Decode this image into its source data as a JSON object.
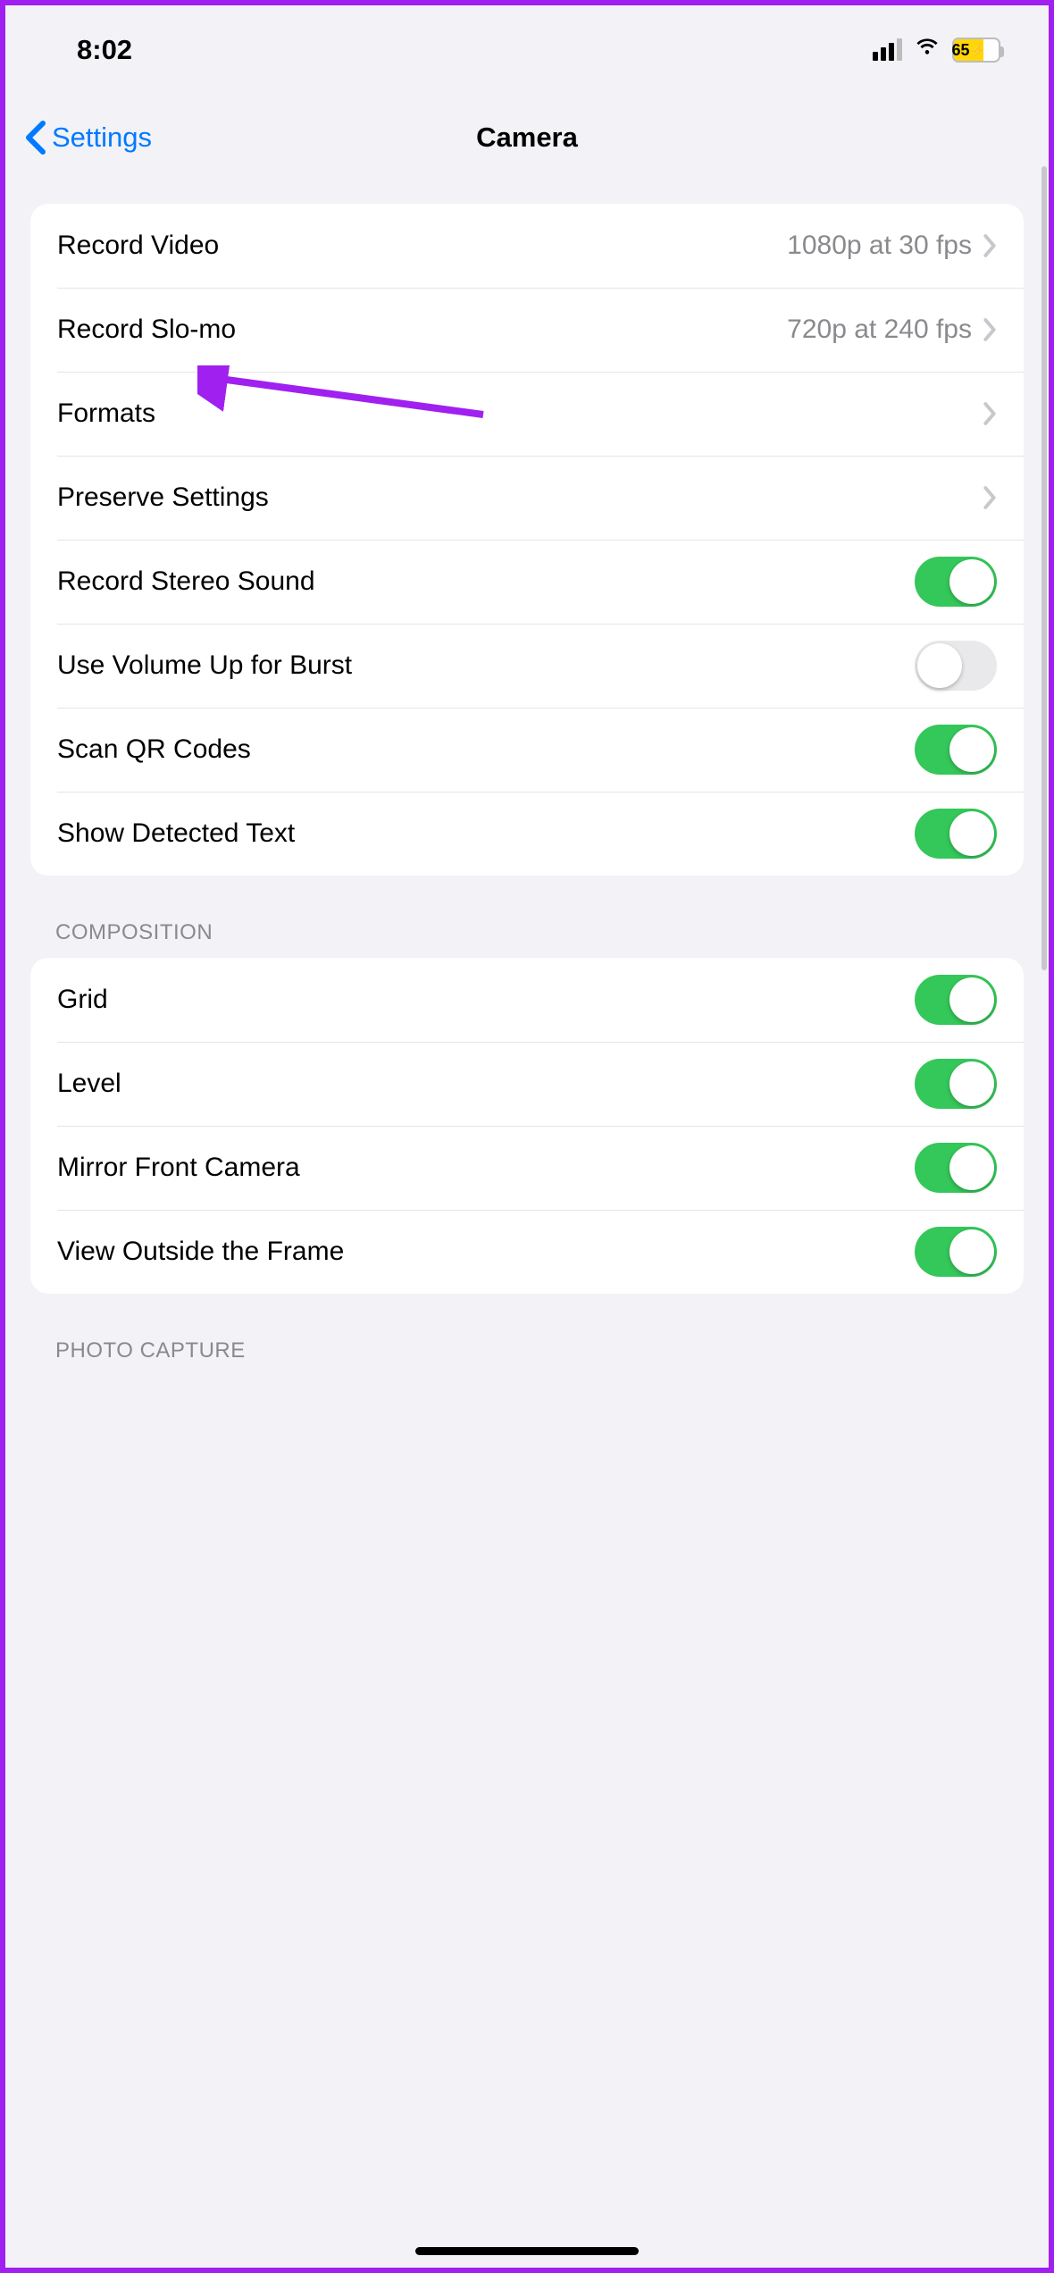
{
  "status": {
    "time": "8:02",
    "battery_pct": "65"
  },
  "nav": {
    "back_label": "Settings",
    "title": "Camera"
  },
  "groups": [
    {
      "header": null,
      "rows": [
        {
          "id": "record-video",
          "type": "link",
          "label": "Record Video",
          "value": "1080p at 30 fps"
        },
        {
          "id": "record-slomo",
          "type": "link",
          "label": "Record Slo-mo",
          "value": "720p at 240 fps"
        },
        {
          "id": "formats",
          "type": "link",
          "label": "Formats",
          "value": ""
        },
        {
          "id": "preserve-settings",
          "type": "link",
          "label": "Preserve Settings",
          "value": ""
        },
        {
          "id": "record-stereo-sound",
          "type": "toggle",
          "label": "Record Stereo Sound",
          "on": true
        },
        {
          "id": "volume-up-burst",
          "type": "toggle",
          "label": "Use Volume Up for Burst",
          "on": false
        },
        {
          "id": "scan-qr-codes",
          "type": "toggle",
          "label": "Scan QR Codes",
          "on": true
        },
        {
          "id": "show-detected-text",
          "type": "toggle",
          "label": "Show Detected Text",
          "on": true
        }
      ]
    },
    {
      "header": "COMPOSITION",
      "rows": [
        {
          "id": "grid",
          "type": "toggle",
          "label": "Grid",
          "on": true
        },
        {
          "id": "level",
          "type": "toggle",
          "label": "Level",
          "on": true
        },
        {
          "id": "mirror-front-camera",
          "type": "toggle",
          "label": "Mirror Front Camera",
          "on": true
        },
        {
          "id": "view-outside-frame",
          "type": "toggle",
          "label": "View Outside the Frame",
          "on": true
        }
      ]
    },
    {
      "header": "PHOTO CAPTURE",
      "rows": []
    }
  ]
}
